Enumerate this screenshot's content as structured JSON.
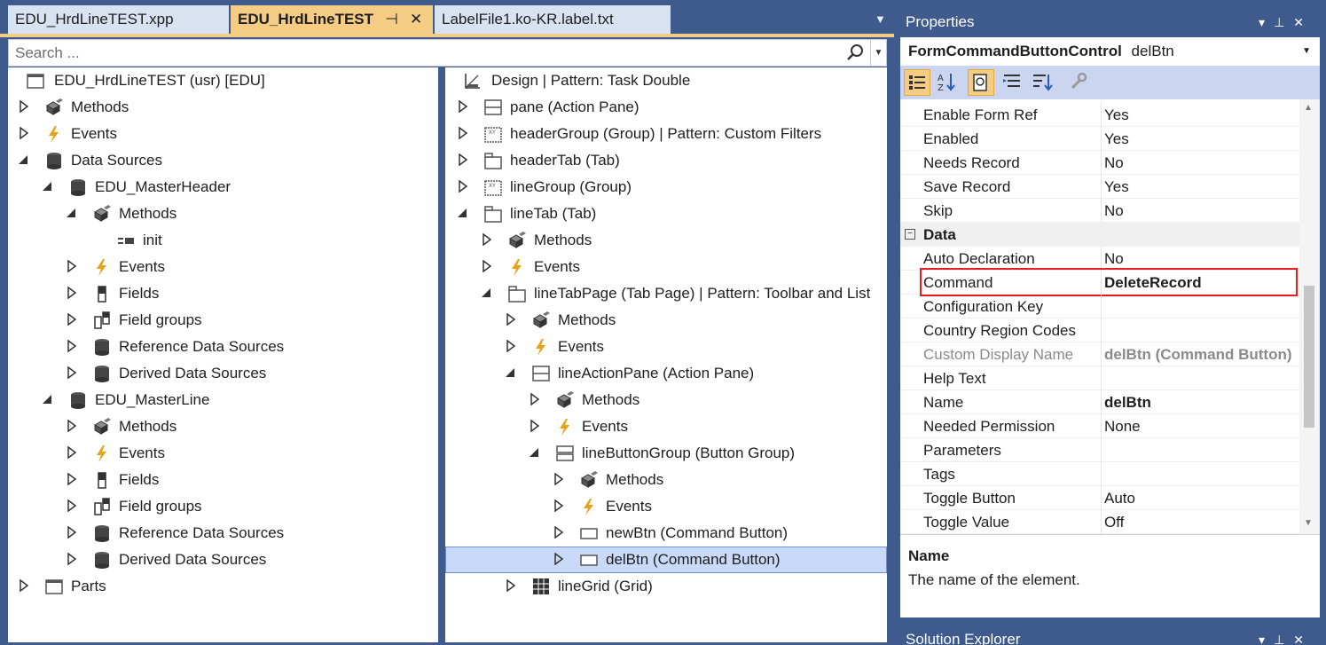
{
  "tabs": [
    {
      "label": "EDU_HrdLineTEST.xpp"
    },
    {
      "label": "EDU_HrdLineTEST"
    },
    {
      "label": "LabelFile1.ko-KR.label.txt"
    }
  ],
  "search": {
    "placeholder": "Search ..."
  },
  "left_tree": [
    {
      "label": "EDU_HrdLineTEST (usr) [EDU]",
      "icon": "form-icon",
      "arrow": "none",
      "indent": 0
    },
    {
      "label": "Methods",
      "icon": "methods-icon",
      "arrow": "collapsed",
      "indent": 0
    },
    {
      "label": "Events",
      "icon": "events-icon",
      "arrow": "collapsed",
      "indent": 0
    },
    {
      "label": "Data Sources",
      "icon": "datasource-icon",
      "arrow": "expanded",
      "indent": 0
    },
    {
      "label": "EDU_MasterHeader",
      "icon": "datasource-icon",
      "arrow": "expanded",
      "indent": 1
    },
    {
      "label": "Methods",
      "icon": "methods-icon",
      "arrow": "expanded",
      "indent": 2
    },
    {
      "label": "init",
      "icon": "method-icon",
      "arrow": "none",
      "indent": 3
    },
    {
      "label": "Events",
      "icon": "events-icon",
      "arrow": "collapsed",
      "indent": 2
    },
    {
      "label": "Fields",
      "icon": "fields-icon",
      "arrow": "collapsed",
      "indent": 2
    },
    {
      "label": "Field groups",
      "icon": "fieldgroups-icon",
      "arrow": "collapsed",
      "indent": 2
    },
    {
      "label": "Reference Data Sources",
      "icon": "datasource-icon",
      "arrow": "collapsed",
      "indent": 2
    },
    {
      "label": "Derived Data Sources",
      "icon": "datasource-icon",
      "arrow": "collapsed",
      "indent": 2
    },
    {
      "label": "EDU_MasterLine",
      "icon": "datasource-icon",
      "arrow": "expanded",
      "indent": 1
    },
    {
      "label": "Methods",
      "icon": "methods-icon",
      "arrow": "collapsed",
      "indent": 2
    },
    {
      "label": "Events",
      "icon": "events-icon",
      "arrow": "collapsed",
      "indent": 2
    },
    {
      "label": "Fields",
      "icon": "fields-icon",
      "arrow": "collapsed",
      "indent": 2
    },
    {
      "label": "Field groups",
      "icon": "fieldgroups-icon",
      "arrow": "collapsed",
      "indent": 2
    },
    {
      "label": "Reference Data Sources",
      "icon": "datasource-icon",
      "arrow": "collapsed",
      "indent": 2
    },
    {
      "label": "Derived Data Sources",
      "icon": "datasource-icon",
      "arrow": "collapsed",
      "indent": 2
    },
    {
      "label": "Parts",
      "icon": "form-icon",
      "arrow": "collapsed",
      "indent": 0
    }
  ],
  "mid_tree": [
    {
      "label": "Design | Pattern: Task Double",
      "icon": "design-icon",
      "arrow": "none",
      "indent": 0
    },
    {
      "label": "pane (Action Pane)",
      "icon": "actionpane-icon",
      "arrow": "collapsed",
      "indent": 0
    },
    {
      "label": "headerGroup (Group) | Pattern: Custom Filters",
      "icon": "group-icon",
      "arrow": "collapsed",
      "indent": 0
    },
    {
      "label": "headerTab (Tab)",
      "icon": "tab-icon",
      "arrow": "collapsed",
      "indent": 0
    },
    {
      "label": "lineGroup (Group)",
      "icon": "group-icon",
      "arrow": "collapsed",
      "indent": 0
    },
    {
      "label": "lineTab (Tab)",
      "icon": "tab-icon",
      "arrow": "expanded",
      "indent": 0
    },
    {
      "label": "Methods",
      "icon": "methods-icon",
      "arrow": "collapsed",
      "indent": 1
    },
    {
      "label": "Events",
      "icon": "events-icon",
      "arrow": "collapsed",
      "indent": 1
    },
    {
      "label": "lineTabPage (Tab Page) | Pattern: Toolbar and List",
      "icon": "tab-icon",
      "arrow": "expanded",
      "indent": 1
    },
    {
      "label": "Methods",
      "icon": "methods-icon",
      "arrow": "collapsed",
      "indent": 2
    },
    {
      "label": "Events",
      "icon": "events-icon",
      "arrow": "collapsed",
      "indent": 2
    },
    {
      "label": "lineActionPane (Action Pane)",
      "icon": "actionpane-icon",
      "arrow": "expanded",
      "indent": 2
    },
    {
      "label": "Methods",
      "icon": "methods-icon",
      "arrow": "collapsed",
      "indent": 3
    },
    {
      "label": "Events",
      "icon": "events-icon",
      "arrow": "collapsed",
      "indent": 3
    },
    {
      "label": "lineButtonGroup (Button Group)",
      "icon": "buttongroup-icon",
      "arrow": "expanded",
      "indent": 3
    },
    {
      "label": "Methods",
      "icon": "methods-icon",
      "arrow": "collapsed",
      "indent": 4
    },
    {
      "label": "Events",
      "icon": "events-icon",
      "arrow": "collapsed",
      "indent": 4
    },
    {
      "label": "newBtn (Command Button)",
      "icon": "button-icon",
      "arrow": "collapsed",
      "indent": 4
    },
    {
      "label": "delBtn (Command Button)",
      "icon": "button-icon",
      "arrow": "collapsed",
      "indent": 4,
      "selected": true
    },
    {
      "label": "lineGrid (Grid)",
      "icon": "grid-icon",
      "arrow": "collapsed",
      "indent": 2
    }
  ],
  "properties": {
    "title": "Properties",
    "object_type": "FormCommandButtonControl",
    "object_name": "delBtn",
    "rows": [
      {
        "name": "Enable Form Ref",
        "value": "Yes"
      },
      {
        "name": "Enabled",
        "value": "Yes"
      },
      {
        "name": "Needs Record",
        "value": "No"
      },
      {
        "name": "Save Record",
        "value": "Yes"
      },
      {
        "name": "Skip",
        "value": "No"
      },
      {
        "name": "Data",
        "value": "",
        "category": true
      },
      {
        "name": "Auto Declaration",
        "value": "No"
      },
      {
        "name": "Command",
        "value": "DeleteRecord",
        "bold": true,
        "highlighted": true
      },
      {
        "name": "Configuration Key",
        "value": ""
      },
      {
        "name": "Country Region Codes",
        "value": ""
      },
      {
        "name": "Custom Display Name",
        "value": "delBtn (Command Button)",
        "bold": true,
        "grey": true
      },
      {
        "name": "Help Text",
        "value": ""
      },
      {
        "name": "Name",
        "value": "delBtn",
        "bold": true
      },
      {
        "name": "Needed Permission",
        "value": "None"
      },
      {
        "name": "Parameters",
        "value": ""
      },
      {
        "name": "Tags",
        "value": ""
      },
      {
        "name": "Toggle Button",
        "value": "Auto"
      },
      {
        "name": "Toggle Value",
        "value": "Off"
      }
    ],
    "description_title": "Name",
    "description_text": "The name of the element."
  },
  "solution_explorer": {
    "title": "Solution Explorer"
  },
  "colors": {
    "frame": "#3f5a8c",
    "active_tab": "#f5cc84",
    "selection": "#c9daf8",
    "highlight_box": "#e02020"
  }
}
